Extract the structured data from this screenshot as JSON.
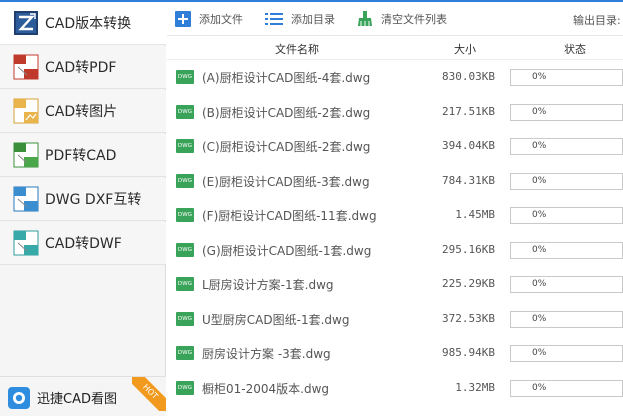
{
  "colors": {
    "accent": "#2f7fd8",
    "file_icon_green": "#3aa35a",
    "hot_orange": "#f29a1e"
  },
  "sidebar": {
    "items": [
      {
        "label": "CAD版本转换",
        "icon": "cad-version-convert-icon",
        "active": true
      },
      {
        "label": "CAD转PDF",
        "icon": "cad-to-pdf-icon",
        "active": false
      },
      {
        "label": "CAD转图片",
        "icon": "cad-to-image-icon",
        "active": false
      },
      {
        "label": "PDF转CAD",
        "icon": "pdf-to-cad-icon",
        "active": false
      },
      {
        "label": "DWG DXF互转",
        "icon": "dwg-dxf-convert-icon",
        "active": false
      },
      {
        "label": "CAD转DWF",
        "icon": "cad-to-dwf-icon",
        "active": false
      }
    ],
    "bottom_app": {
      "label": "迅捷CAD看图",
      "badge": "HOT",
      "icon": "cad-viewer-app-icon"
    }
  },
  "toolbar": {
    "add_file": "添加文件",
    "add_folder": "添加目录",
    "clear_list": "清空文件列表",
    "output_dir": "输出目录:"
  },
  "table": {
    "headers": {
      "name": "文件名称",
      "size": "大小",
      "status": "状态"
    },
    "file_icon_label": "DWG",
    "rows": [
      {
        "name": "(A)厨柜设计CAD图纸-4套.dwg",
        "size": "830.03KB",
        "progress": "0%",
        "fraction": 0
      },
      {
        "name": "(B)厨柜设计CAD图纸-2套.dwg",
        "size": "217.51KB",
        "progress": "0%",
        "fraction": 0
      },
      {
        "name": "(C)厨柜设计CAD图纸-2套.dwg",
        "size": "394.04KB",
        "progress": "0%",
        "fraction": 0
      },
      {
        "name": "(E)厨柜设计CAD图纸-3套.dwg",
        "size": "784.31KB",
        "progress": "0%",
        "fraction": 0
      },
      {
        "name": "(F)厨柜设计CAD图纸-11套.dwg",
        "size": "1.45MB",
        "progress": "0%",
        "fraction": 0
      },
      {
        "name": "(G)厨柜设计CAD图纸-1套.dwg",
        "size": "295.16KB",
        "progress": "0%",
        "fraction": 0
      },
      {
        "name": "L厨房设计方案-1套.dwg",
        "size": "225.29KB",
        "progress": "0%",
        "fraction": 0
      },
      {
        "name": "U型厨房CAD图纸-1套.dwg",
        "size": "372.53KB",
        "progress": "0%",
        "fraction": 0
      },
      {
        "name": "厨房设计方案 -3套.dwg",
        "size": "985.94KB",
        "progress": "0%",
        "fraction": 0
      },
      {
        "name": "橱柜01-2004版本.dwg",
        "size": "1.32MB",
        "progress": "0%",
        "fraction": 0
      }
    ]
  }
}
